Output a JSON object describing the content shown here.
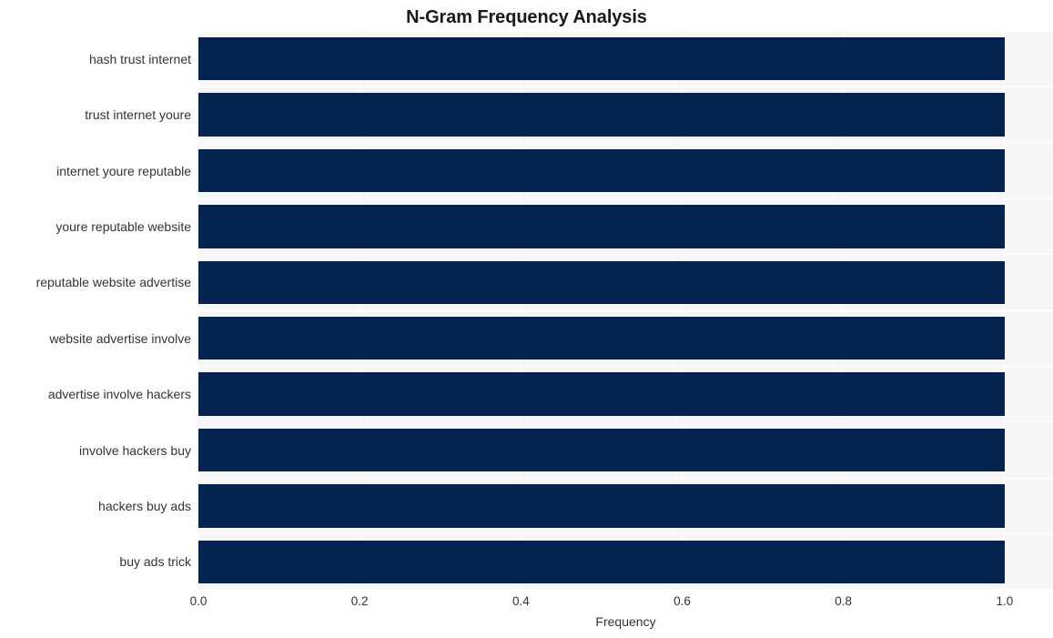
{
  "chart_data": {
    "type": "bar",
    "orientation": "horizontal",
    "title": "N-Gram Frequency Analysis",
    "xlabel": "Frequency",
    "ylabel": "",
    "categories": [
      "hash trust internet",
      "trust internet youre",
      "internet youre reputable",
      "youre reputable website",
      "reputable website advertise",
      "website advertise involve",
      "advertise involve hackers",
      "involve hackers buy",
      "hackers buy ads",
      "buy ads trick"
    ],
    "values": [
      1.0,
      1.0,
      1.0,
      1.0,
      1.0,
      1.0,
      1.0,
      1.0,
      1.0,
      1.0
    ],
    "xticks": [
      "0.0",
      "0.2",
      "0.4",
      "0.6",
      "0.8",
      "1.0"
    ],
    "xtick_values": [
      0.0,
      0.2,
      0.4,
      0.6,
      0.8,
      1.0
    ],
    "xlim": [
      0.0,
      1.06
    ],
    "ylim": [
      -0.5,
      9.5
    ],
    "grid": true,
    "legend": false,
    "bar_color": "#04234f",
    "plot_background": "#f6f6f7",
    "grid_color": "#ffffff",
    "figure_background": "#ffffff",
    "text_color": "#333333",
    "title_color": "#1a1a1a"
  }
}
